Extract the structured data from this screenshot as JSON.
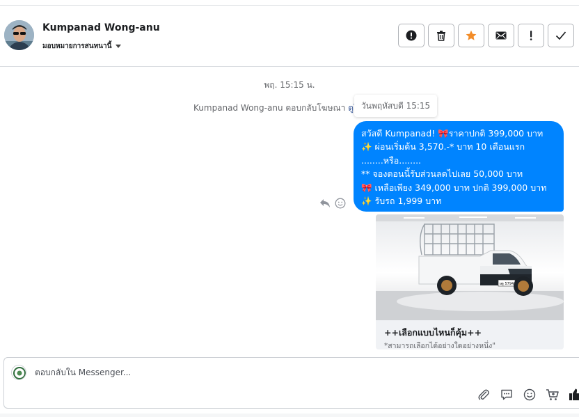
{
  "header": {
    "contact_name": "Kumpanad Wong-anu",
    "assign_label": "มอบหมายการสนทนานี้",
    "actions": [
      {
        "name": "spam-button",
        "icon": "alert-circle-icon"
      },
      {
        "name": "delete-button",
        "icon": "trash-icon"
      },
      {
        "name": "star-button",
        "icon": "star-icon",
        "color": "#f28c28"
      },
      {
        "name": "mark-unread-button",
        "icon": "envelope-icon"
      },
      {
        "name": "follow-up-button",
        "icon": "exclamation-icon"
      },
      {
        "name": "done-button",
        "icon": "check-icon"
      }
    ]
  },
  "chat": {
    "timestamp": "พฤ. 15:15 น.",
    "reply_note_prefix": "Kumpanad Wong-anu ตอบกลับโฆษณา",
    "reply_note_link": "ดูโฆษณา",
    "tooltip": "วันพฤหัสบดี 15:15",
    "message_lines": [
      "สวัสดี Kumpanad! 🎀ราคาปกติ 399,000 บาท",
      "✨ ผ่อนเริ่มต้น 3,570.-* บาท 10 เดือนแรก",
      "........หรือ........",
      "** จองตอนนี้รับส่วนลดไปเลย 50,000 บาท",
      "🎀 เหลือเพียง 349,000 บาท ปกติ 399,000 บาท",
      "✨ รับรถ 1,999 บาท"
    ],
    "card": {
      "title": "++เลือกแบบไหนก็คุ้ม++",
      "subtitle": "*สามารถเลือกได้อย่างใดอย่างหนึ่ง\"",
      "plate": "ษฐ 5794"
    }
  },
  "composer": {
    "placeholder": "ตอบกลับใน Messenger..."
  },
  "colors": {
    "bubble": "#0084ff",
    "star": "#f28c28",
    "link": "#385898"
  }
}
